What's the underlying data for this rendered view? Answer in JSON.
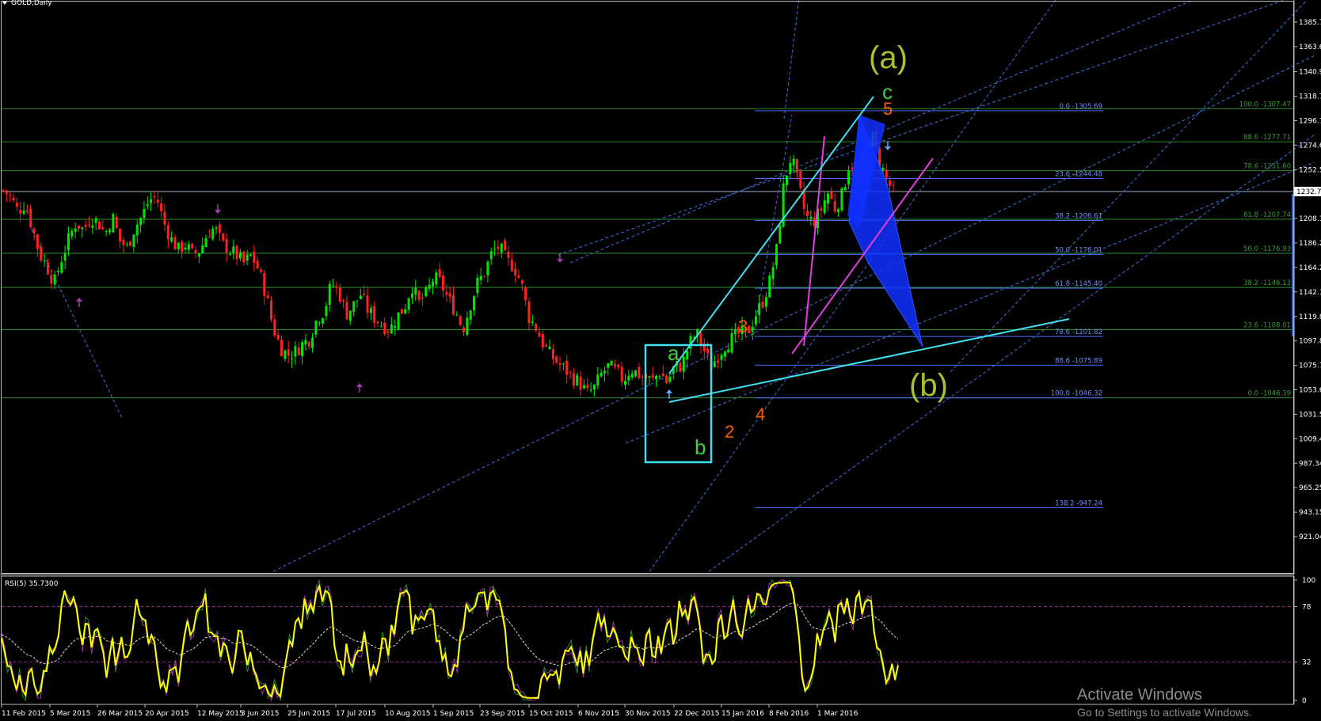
{
  "window": {
    "symbol_title": "GOLD,Daily",
    "rsi_title": "RSI(5) 35.7300",
    "watermark_line1": "Activate Windows",
    "watermark_line2": "Go to Settings to activate Windows."
  },
  "chart_data": {
    "type": "candlestick",
    "symbol": "GOLD",
    "timeframe": "Daily",
    "ylim": [
      921.04,
      1385.7
    ],
    "price_ticks": [
      "1385.75",
      "1363.60",
      "1340.90",
      "1318.75",
      "1296.70",
      "1274.65",
      "1252.55",
      "1230.50",
      "1208.35",
      "1186.25",
      "1164.20",
      "1142.10",
      "1119.85",
      "1097.80",
      "1075.70",
      "1053.65",
      "1031.55",
      "1009.45",
      "987.34",
      "965.25",
      "943.15",
      "921.04"
    ],
    "current_price": "1232.7",
    "date_labels": [
      "11 Feb 2015",
      "5 Mar 2015",
      "26 Mar 2015",
      "20 Apr 2015",
      "12 May 2015",
      "3 Jun 2015",
      "25 Jun 2015",
      "17 Jul 2015",
      "10 Aug 2015",
      "1 Sep 2015",
      "23 Sep 2015",
      "15 Oct 2015",
      "6 Nov 2015",
      "30 Nov 2015",
      "22 Dec 2015",
      "15 Jan 2016",
      "8 Feb 2016",
      "1 Mar 2016"
    ],
    "price_path": [
      1234,
      1228,
      1215,
      1222,
      1200,
      1176,
      1165,
      1150,
      1172,
      1190,
      1205,
      1198,
      1210,
      1205,
      1195,
      1210,
      1188,
      1182,
      1200,
      1210,
      1225,
      1228,
      1205,
      1190,
      1180,
      1185,
      1175,
      1180,
      1195,
      1200,
      1185,
      1180,
      1175,
      1168,
      1175,
      1162,
      1140,
      1110,
      1092,
      1085,
      1088,
      1095,
      1100,
      1118,
      1125,
      1150,
      1142,
      1122,
      1130,
      1140,
      1125,
      1118,
      1112,
      1108,
      1120,
      1128,
      1148,
      1132,
      1140,
      1155,
      1150,
      1135,
      1125,
      1108,
      1130,
      1150,
      1160,
      1178,
      1183,
      1170,
      1165,
      1150,
      1120,
      1110,
      1095,
      1085,
      1078,
      1072,
      1065,
      1060,
      1050,
      1055,
      1068,
      1075,
      1070,
      1062,
      1073,
      1068,
      1064,
      1062,
      1070,
      1060,
      1075,
      1075,
      1095,
      1105,
      1090,
      1075,
      1085,
      1095,
      1100,
      1105,
      1105,
      1120,
      1132,
      1150,
      1180,
      1240,
      1265,
      1238,
      1210,
      1205,
      1215,
      1232,
      1218,
      1230,
      1260,
      1252,
      1270,
      1285,
      1262,
      1245,
      1232
    ],
    "fib_left": [
      {
        "label": "0.0 -1305.69",
        "price": 1305.69
      },
      {
        "label": "23.6 -1244.48",
        "price": 1244.48
      },
      {
        "label": "38.2 -1206.61",
        "price": 1206.61
      },
      {
        "label": "50.0 -1176.01",
        "price": 1176.01
      },
      {
        "label": "61.8 -1145.40",
        "price": 1145.4
      },
      {
        "label": "78.6 -1101.82",
        "price": 1101.82
      },
      {
        "label": "88.6 -1075.89",
        "price": 1075.89
      },
      {
        "label": "100.0 -1046.32",
        "price": 1046.32
      },
      {
        "label": "138.2 -947.24",
        "price": 947.24
      }
    ],
    "fib_right": [
      {
        "label": "100.0 -1307.47",
        "price": 1307.47
      },
      {
        "label": "88.6 -1277.71",
        "price": 1277.71
      },
      {
        "label": "78.6 -1251.60",
        "price": 1251.6
      },
      {
        "label": "61.8 -1207.74",
        "price": 1207.74
      },
      {
        "label": "50.0 -1176.93",
        "price": 1176.93
      },
      {
        "label": "38.2 -1146.13",
        "price": 1146.13
      },
      {
        "label": "23.6 -1108.01",
        "price": 1108.01
      },
      {
        "label": "0.0 -1046.39",
        "price": 1046.39
      }
    ],
    "wave_labels": {
      "big_a": "(a)",
      "big_b": "(b)",
      "minor_a": "a",
      "minor_b": "b",
      "minor_c": "c",
      "n2": "2",
      "n3": "3",
      "n4": "4",
      "n5": "5"
    },
    "rsi": {
      "name": "RSI(5)",
      "value": "35.7300",
      "ylim": [
        0,
        100
      ],
      "levels": [
        78,
        32
      ],
      "ticks": [
        "100",
        "78",
        "32",
        "0"
      ]
    },
    "colors": {
      "bull": "#00e600",
      "bear": "#ff2020",
      "fib_left": "#4a6cff",
      "fib_right": "#2a8a2a",
      "channel": "#3f6fe0",
      "cyan": "#40e0f0",
      "magenta": "#e040e0",
      "pattern": "#1030ff",
      "rsi": "#ffff00",
      "wave_orange": "#ff5a00",
      "wave_green": "#40d040",
      "wave_olive": "#a8c030"
    }
  }
}
